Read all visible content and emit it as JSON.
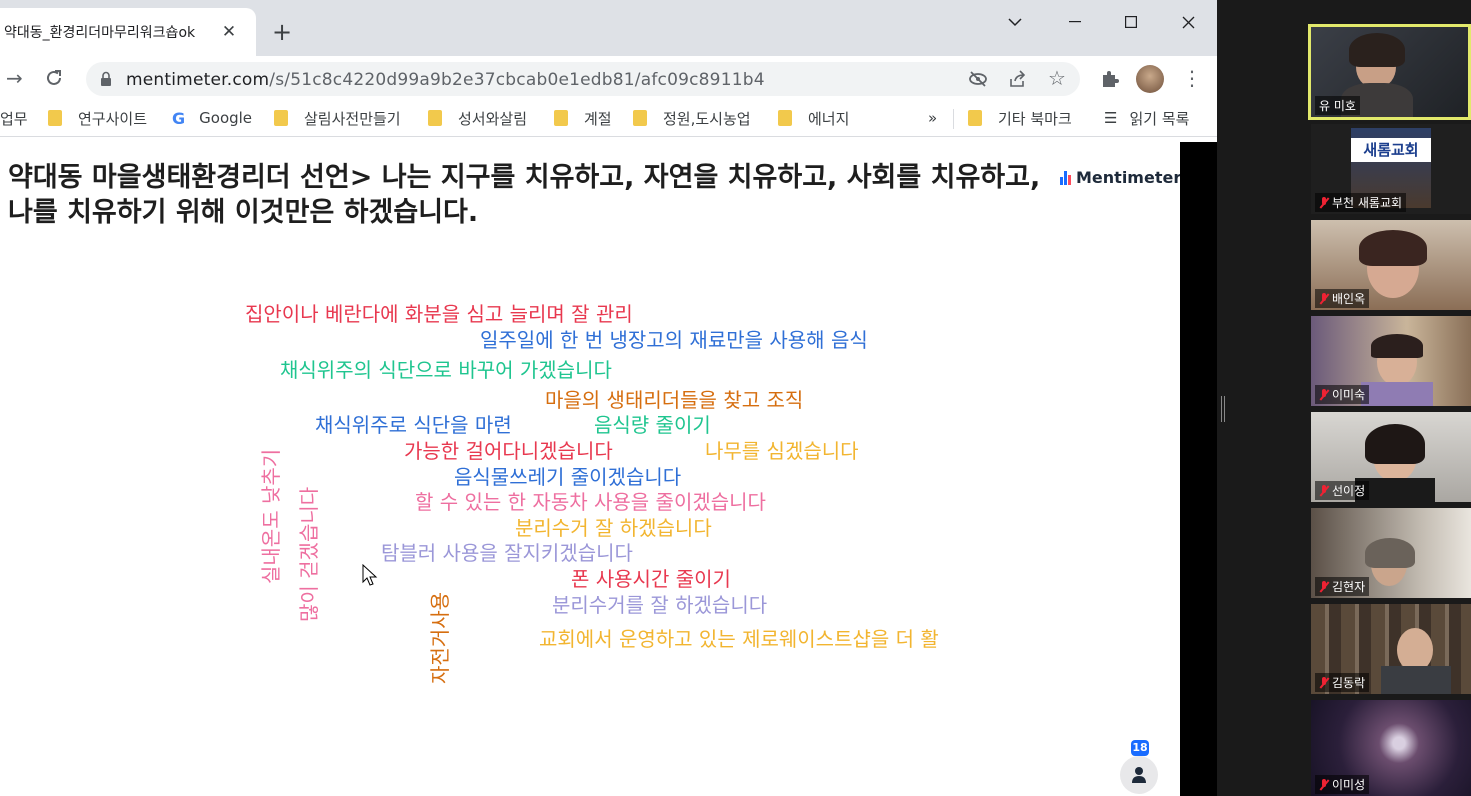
{
  "browser": {
    "tab_title": "약대동_환경리더마무리워크숍ok",
    "new_tab": "+",
    "url_host": "mentimeter.com",
    "url_path": "/s/51c8c4220d99a9b2e37cbcab0e1edb81/afc09c8911b4",
    "bookmarks": [
      {
        "label": "업무",
        "icon": "folder-icon"
      },
      {
        "label": "연구사이트",
        "icon": "folder-icon"
      },
      {
        "label": "Google",
        "icon": "google-icon"
      },
      {
        "label": "살림사전만들기",
        "icon": "folder-icon"
      },
      {
        "label": "성서와살림",
        "icon": "folder-icon"
      },
      {
        "label": "계절",
        "icon": "folder-icon"
      },
      {
        "label": "정원,도시농업",
        "icon": "folder-icon"
      },
      {
        "label": "에너지",
        "icon": "folder-icon"
      }
    ],
    "bookmarks_more": "»",
    "other_bookmarks": "기타 북마크",
    "reading_list": "읽기 목록"
  },
  "slide": {
    "question": "약대동 마을생태환경리더 선언> 나는 지구를 치유하고, 자연을 치유하고, 사회를 치유하고, 나를 치유하기 위해 이것만은 하겠습니다.",
    "brand": "Mentimeter",
    "participant_count": "18",
    "words": [
      {
        "text": "집안이나 베란다에 화분을 심고 늘리며 잘 관리",
        "color": "#e8384f"
      },
      {
        "text": "일주일에 한 번 냉장고의 재료만을 사용해 음식",
        "color": "#2f6fd6"
      },
      {
        "text": "채식위주의 식단으로 바꾸어 가겠습니다",
        "color": "#1fc58f"
      },
      {
        "text": "마을의 생태리더들을 찾고 조직",
        "color": "#d66e0f"
      },
      {
        "text": "채식위주로 식단을 마련",
        "color": "#2f6fd6"
      },
      {
        "text": "음식량 줄이기",
        "color": "#1fc58f"
      },
      {
        "text": "가능한 걸어다니겠습니다",
        "color": "#e8384f"
      },
      {
        "text": "나무를 심겠습니다",
        "color": "#f2b530"
      },
      {
        "text": "음식물쓰레기 줄이겠습니다",
        "color": "#2f6fd6"
      },
      {
        "text": "할 수 있는 한 자동차 사용을 줄이겠습니다",
        "color": "#ee6fa0"
      },
      {
        "text": "분리수거 잘 하겠습니다",
        "color": "#f2b530"
      },
      {
        "text": "탐블러 사용을 잘지키겠습니다",
        "color": "#9b97d8"
      },
      {
        "text": "폰 사용시간 줄이기",
        "color": "#e8384f"
      },
      {
        "text": "분리수거를 잘 하겠습니다",
        "color": "#9b97d8"
      },
      {
        "text": "교회에서 운영하고 있는 제로웨이스트샵을 더 활",
        "color": "#f2b530"
      },
      {
        "text": "실내온도 낮추기",
        "color": "#ee6fa0"
      },
      {
        "text": "많이 걷겠습니다",
        "color": "#ee6fa0"
      },
      {
        "text": "자전거사용",
        "color": "#d66e0f"
      }
    ]
  },
  "zoom": {
    "participants": [
      {
        "name": "유 미호",
        "muted": false,
        "active": true
      },
      {
        "name": "부천 새롬교회",
        "muted": true,
        "active": false
      },
      {
        "name": "배인옥",
        "muted": true,
        "active": false
      },
      {
        "name": "이미숙",
        "muted": true,
        "active": false
      },
      {
        "name": "선이정",
        "muted": true,
        "active": false
      },
      {
        "name": "김현자",
        "muted": true,
        "active": false
      },
      {
        "name": "김동락",
        "muted": true,
        "active": false
      },
      {
        "name": "이미성",
        "muted": true,
        "active": false
      }
    ],
    "church_sign_text": "새롬교회"
  },
  "colors": {
    "tabstrip": "#dee1e6",
    "active_speaker_border": "#e2e96b",
    "brand_blue": "#196cff"
  }
}
